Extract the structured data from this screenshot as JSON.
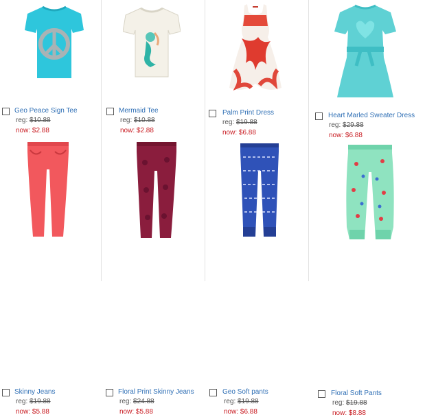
{
  "colors": {
    "link": "#2f6fb5",
    "sale": "#c8191f",
    "divider": "#e2e2e2"
  },
  "products": [
    {
      "name": "Geo Peace Sign Tee",
      "reg_label": "reg:",
      "reg_price": "$10.88",
      "now_label": "now:",
      "now_price": "$2.88",
      "image": "tshirt-turquoise-peace-sign"
    },
    {
      "name": "Mermaid Tee",
      "reg_label": "reg:",
      "reg_price": "$10.88",
      "now_label": "now:",
      "now_price": "$2.88",
      "image": "tshirt-white-mermaid"
    },
    {
      "name": "Palm Print Dress",
      "reg_label": "reg:",
      "reg_price": "$19.88",
      "now_label": "now:",
      "now_price": "$6.88",
      "image": "dress-red-palm-print"
    },
    {
      "name": "Heart Marled Sweater Dress",
      "reg_label": "reg:",
      "reg_price": "$29.88",
      "now_label": "now:",
      "now_price": "$6.88",
      "image": "dress-aqua-heart-sweater"
    },
    {
      "name": "Skinny Jeans",
      "reg_label": "reg:",
      "reg_price": "$19.88",
      "now_label": "now:",
      "now_price": "$5.88",
      "image": "jeans-coral-skinny"
    },
    {
      "name": "Floral Print Skinny Jeans",
      "reg_label": "reg:",
      "reg_price": "$24.88",
      "now_label": "now:",
      "now_price": "$5.88",
      "image": "jeans-burgundy-floral"
    },
    {
      "name": "Geo Soft pants",
      "reg_label": "reg:",
      "reg_price": "$19.88",
      "now_label": "now:",
      "now_price": "$6.88",
      "image": "pants-blue-geo"
    },
    {
      "name": "Floral Soft Pants",
      "reg_label": "reg:",
      "reg_price": "$19.88",
      "now_label": "now:",
      "now_price": "$8.88",
      "image": "pants-mint-floral"
    }
  ]
}
